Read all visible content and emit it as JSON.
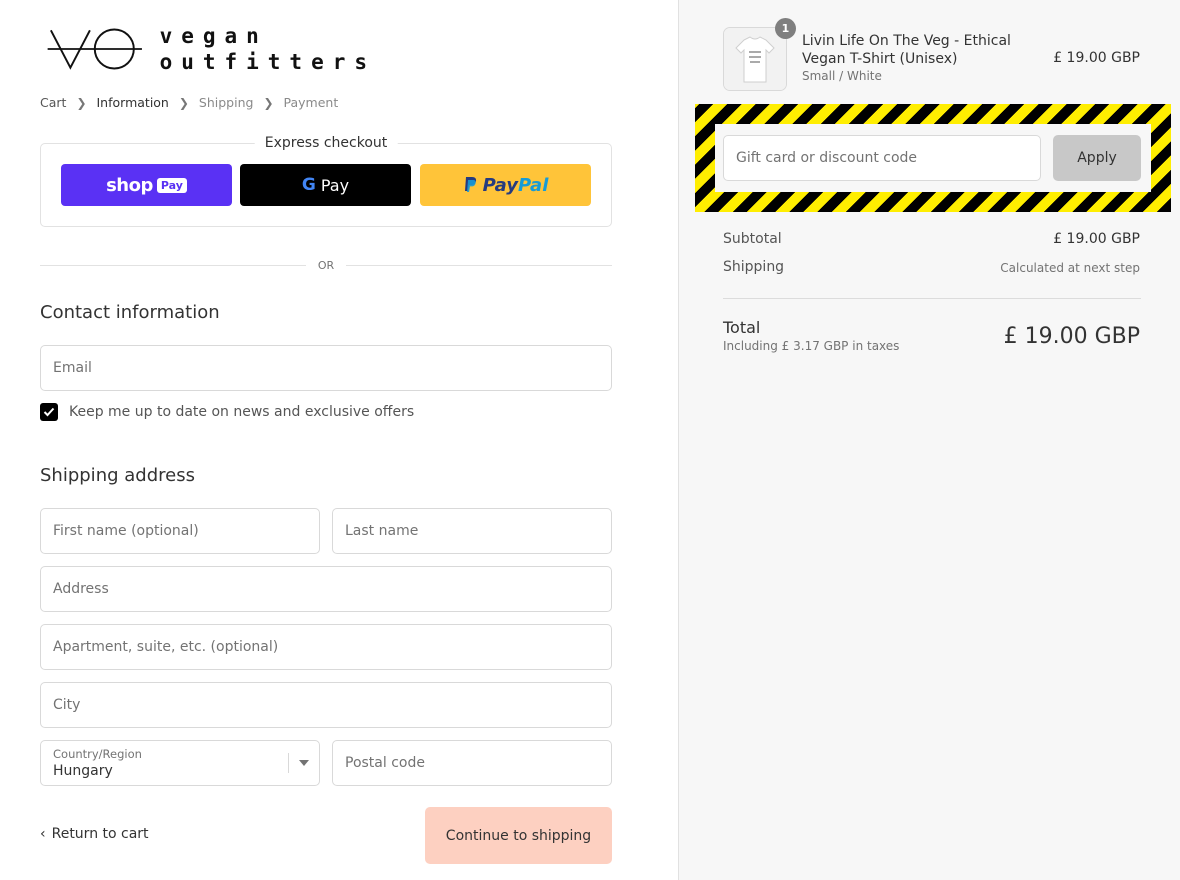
{
  "brand": {
    "logo_text_line1": "vegan",
    "logo_text_line2": "outfitters"
  },
  "breadcrumb": [
    {
      "label": "Cart"
    },
    {
      "label": "Information"
    },
    {
      "label": "Shipping"
    },
    {
      "label": "Payment"
    }
  ],
  "express": {
    "title": "Express checkout",
    "shop_pay": {
      "word": "shop",
      "badge": "Pay"
    },
    "gpay": {
      "letter": "G",
      "text": "Pay"
    },
    "paypal": {
      "part1": "Pay",
      "part2": "Pal"
    }
  },
  "or_text": "OR",
  "contact": {
    "title": "Contact information",
    "email_placeholder": "Email",
    "newsletter_label": "Keep me up to date on news and exclusive offers",
    "newsletter_checked": true
  },
  "shipping": {
    "title": "Shipping address",
    "first_name_placeholder": "First name (optional)",
    "last_name_placeholder": "Last name",
    "address_placeholder": "Address",
    "apartment_placeholder": "Apartment, suite, etc. (optional)",
    "city_placeholder": "City",
    "country_label": "Country/Region",
    "country_value": "Hungary",
    "postal_placeholder": "Postal code"
  },
  "actions": {
    "return_label": "Return to cart",
    "continue_label": "Continue to shipping"
  },
  "order": {
    "quantity": "1",
    "product_name": "Livin Life On The Veg - Ethical Vegan T-Shirt (Unisex)",
    "variant": "Small / White",
    "price": "£ 19.00 GBP",
    "discount_placeholder": "Gift card or discount code",
    "apply_label": "Apply",
    "subtotal_label": "Subtotal",
    "subtotal_value": "£ 19.00 GBP",
    "shipping_label": "Shipping",
    "shipping_value": "Calculated at next step",
    "total_label": "Total",
    "tax_note": "Including £ 3.17 GBP in taxes",
    "total_value": "£ 19.00 GBP"
  },
  "colors": {
    "shop_pay": "#5a31f4",
    "gpay": "#000000",
    "paypal": "#ffc439",
    "continue_button": "#fdd0c1",
    "hazard_yellow": "#ffee00",
    "hazard_black": "#000000"
  }
}
